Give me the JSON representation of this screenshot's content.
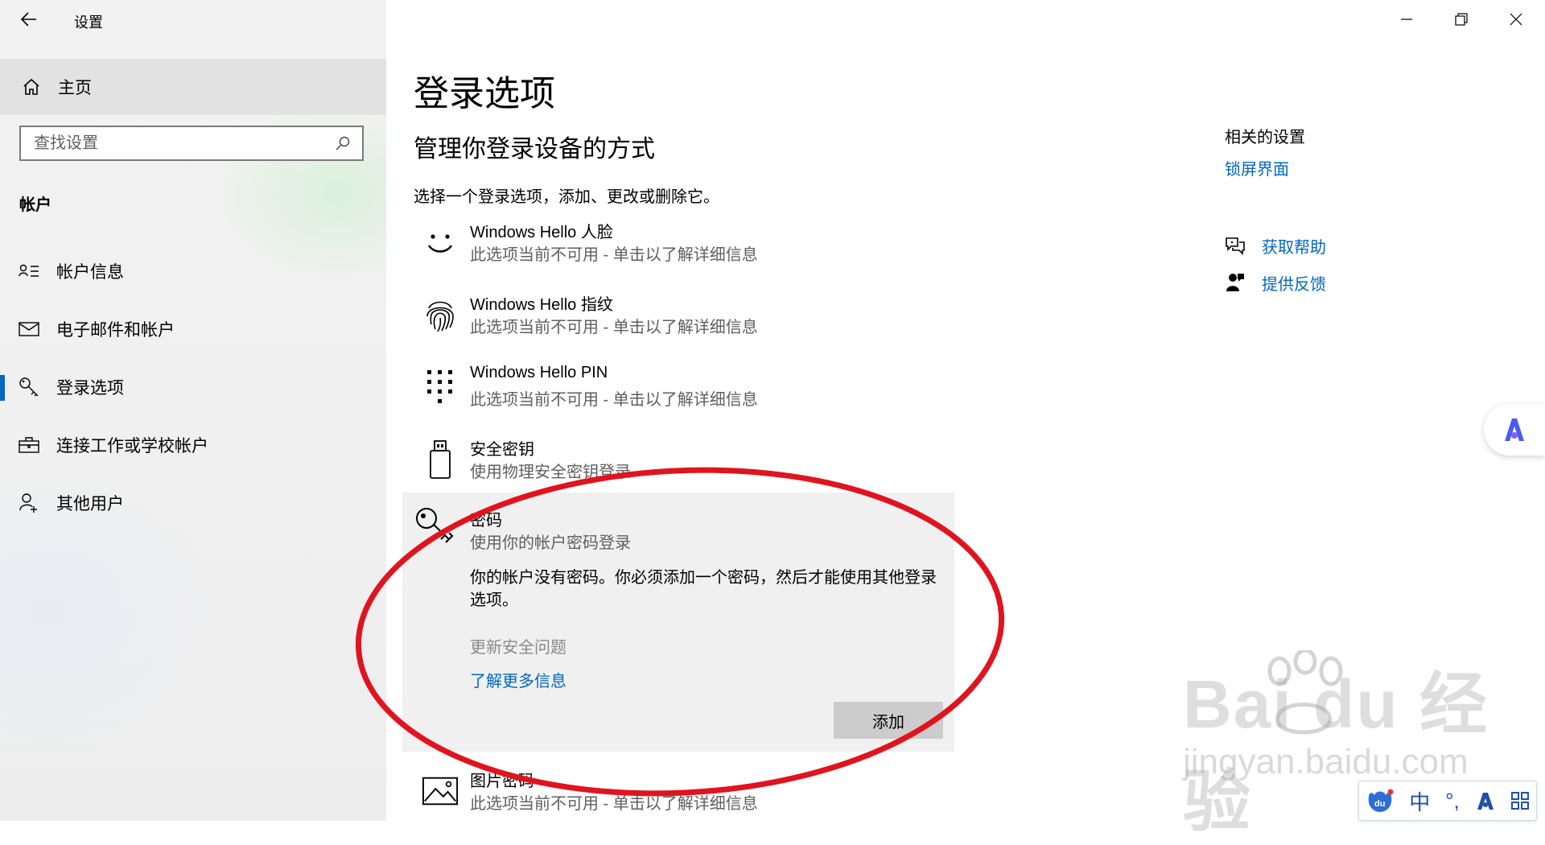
{
  "window": {
    "title": "设置"
  },
  "sidebar": {
    "home_label": "主页",
    "search_placeholder": "查找设置",
    "section_title": "帐户",
    "items": [
      {
        "label": "帐户信息",
        "icon": "account-info-icon"
      },
      {
        "label": "电子邮件和帐户",
        "icon": "mail-icon"
      },
      {
        "label": "登录选项",
        "icon": "key-icon",
        "active": true
      },
      {
        "label": "连接工作或学校帐户",
        "icon": "briefcase-icon"
      },
      {
        "label": "其他用户",
        "icon": "add-user-icon"
      }
    ]
  },
  "main": {
    "title": "登录选项",
    "subtitle": "管理你登录设备的方式",
    "description": "选择一个登录选项，添加、更改或删除它。",
    "options": [
      {
        "title": "Windows Hello 人脸",
        "subtitle": "此选项当前不可用 - 单击以了解详细信息",
        "icon": "face-icon"
      },
      {
        "title": "Windows Hello 指纹",
        "subtitle": "此选项当前不可用 - 单击以了解详细信息",
        "icon": "fingerprint-icon"
      },
      {
        "title": "Windows Hello PIN",
        "subtitle": "此选项当前不可用 - 单击以了解详细信息",
        "icon": "keypad-icon"
      },
      {
        "title": "安全密钥",
        "subtitle": "使用物理安全密钥登录",
        "icon": "usb-key-icon"
      }
    ],
    "password": {
      "title": "密码",
      "subtitle": "使用你的帐户密码登录",
      "message": "你的帐户没有密码。你必须添加一个密码，然后才能使用其他登录选项。",
      "update_security_questions": "更新安全问题",
      "learn_more": "了解更多信息",
      "add_button": "添加"
    },
    "picture_password": {
      "title": "图片密码",
      "subtitle": "此选项当前不可用 - 单击以了解详细信息",
      "icon": "picture-icon"
    }
  },
  "related": {
    "title": "相关的设置",
    "lock_screen_link": "锁屏界面",
    "get_help": "获取帮助",
    "give_feedback": "提供反馈"
  },
  "watermark": {
    "brand": "Bai  du 经验",
    "url": "jingyan.baidu.com"
  },
  "ime": {
    "mode": "中",
    "punct": "°,"
  },
  "colors": {
    "accent": "#0067c0",
    "annotation": "#e0141e",
    "panel": "#f0f0f0"
  }
}
